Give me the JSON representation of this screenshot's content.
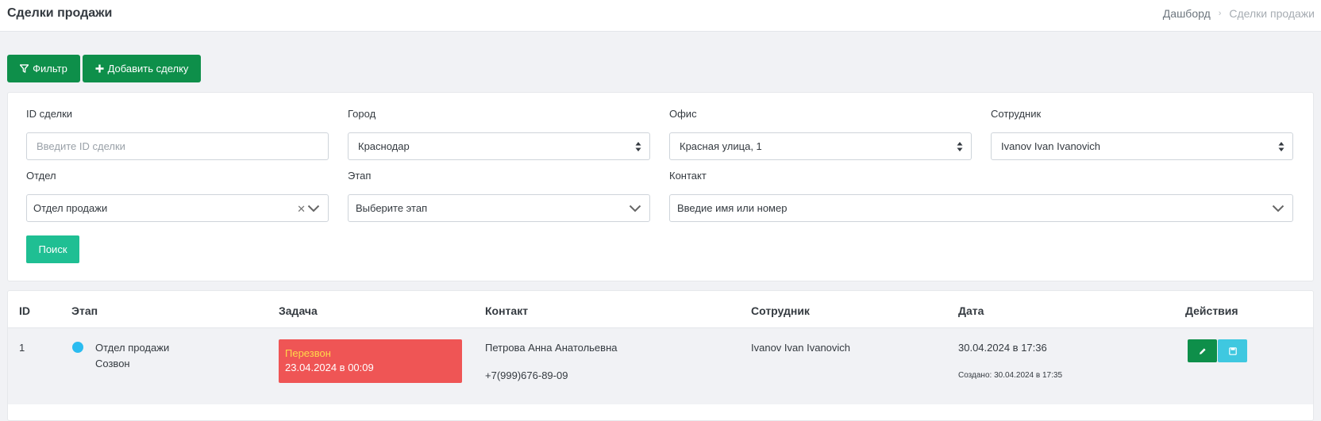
{
  "header": {
    "title": "Сделки продажи",
    "breadcrumb": {
      "home": "Дашборд",
      "current": "Сделки продажи"
    }
  },
  "toolbar": {
    "filter_label": "Фильтр",
    "add_label": "Добавить сделку"
  },
  "filters": {
    "deal_id": {
      "label": "ID сделки",
      "placeholder": "Введите ID сделки"
    },
    "city": {
      "label": "Город",
      "value": "Краснодар"
    },
    "office": {
      "label": "Офис",
      "value": "Красная улица, 1"
    },
    "employee": {
      "label": "Сотрудник",
      "value": "Ivanov Ivan Ivanovich"
    },
    "department": {
      "label": "Отдел",
      "value": "Отдел продажи"
    },
    "stage": {
      "label": "Этап",
      "placeholder": "Выберите этап"
    },
    "contact": {
      "label": "Контакт",
      "placeholder": "Введие имя или номер"
    },
    "search_label": "Поиск"
  },
  "table": {
    "columns": [
      "ID",
      "Этап",
      "Задача",
      "Контакт",
      "Сотрудник",
      "Дата",
      "Действия"
    ],
    "rows": [
      {
        "id": "1",
        "stage_department": "Отдел продажи",
        "stage_name": "Созвон",
        "task_title": "Перезвон",
        "task_date": "23.04.2024 в 00:09",
        "contact_name": "Петрова Анна Анатольевна",
        "contact_phone": "+7(999)676-89-09",
        "employee": "Ivanov Ivan Ivanovich",
        "date": "30.04.2024 в 17:36",
        "created": "Создано: 30.04.2024 в 17:35"
      }
    ]
  },
  "colors": {
    "primary_green": "#0e8f4a",
    "search_teal": "#1fbf93",
    "task_red": "#ef5555",
    "task_title_yellow": "#ffd84a",
    "stage_dot_blue": "#2bbcf0",
    "save_cyan": "#3fc8e0"
  },
  "icons": {
    "filter": "filter-icon",
    "add": "plus-icon",
    "select_arrows": "sort-arrows-icon",
    "dropdown": "chevron-down-icon",
    "clear": "close-icon",
    "edit": "pencil-icon",
    "save": "floppy-disk-icon"
  }
}
